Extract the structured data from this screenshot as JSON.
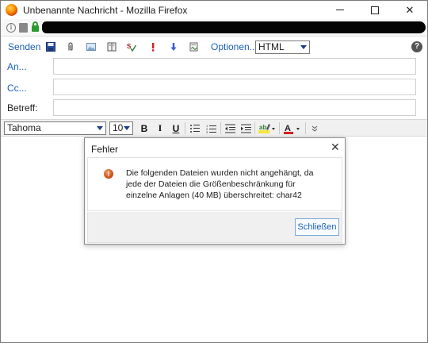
{
  "window": {
    "title": "Unbenannte Nachricht - Mozilla Firefox",
    "controls": {
      "minimize": "",
      "maximize": "",
      "close": "✕"
    }
  },
  "compose_toolbar": {
    "send": "Senden",
    "options": "Optionen...",
    "format_select": "HTML",
    "help": "?",
    "icons": [
      "save-icon",
      "attach-icon",
      "image-icon",
      "address-book-icon",
      "spellcheck-icon",
      "priority-high-icon",
      "priority-low-icon",
      "signature-icon"
    ]
  },
  "fields": {
    "to_label": "An...",
    "cc_label": "Cc...",
    "subject_label": "Betreff:"
  },
  "format_toolbar": {
    "font": "Tahoma",
    "size": "10",
    "bold": "B",
    "italic": "I",
    "underline": "U"
  },
  "dialog": {
    "title": "Fehler",
    "close": "✕",
    "message": "Die folgenden Dateien wurden nicht angehängt, da jede der Dateien die Größenbeschränkung für einzelne Anlagen (40 MB) überschreitet: char42",
    "ok_button": "Schließen"
  },
  "colors": {
    "link": "#1a5fb4",
    "warning": "#d2561a",
    "highlight": "#f4e63b",
    "font_color": "#d42020"
  }
}
